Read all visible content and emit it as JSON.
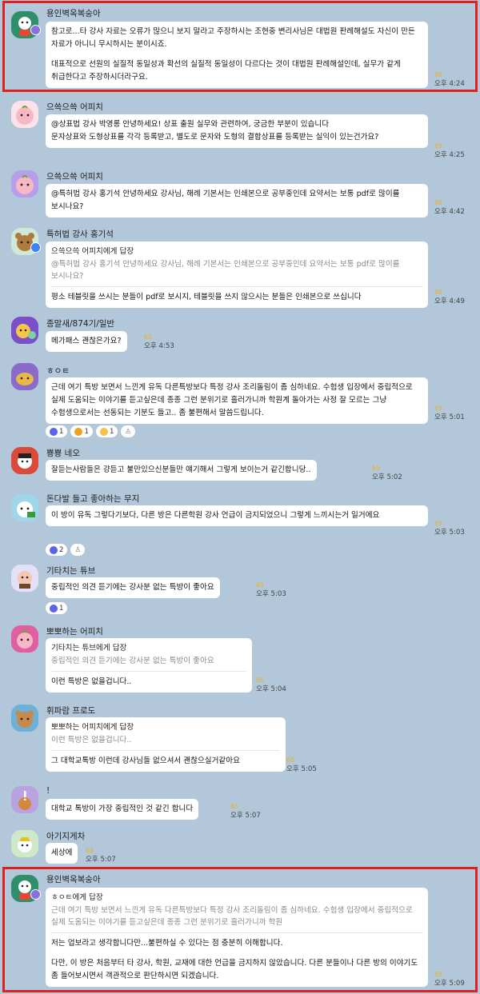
{
  "messages": [
    {
      "name": "용인벽옥복숭아",
      "lines": [
        "참고로...타 강사 자료는 오류가 많으니 보지 말라고 주장하시는 조현중 변리사님은 대법원 판례해설도 자신이 만든 자료가 아니니 무시하시는 분이시죠.",
        "",
        "대표적으로 선원의 실질적 동일성과 확선의 실질적 동일성이 다르다는 것이 대법원 판례해설인데, 실무가 같게 취급한다고 주장하시더라구요."
      ],
      "unread": "65",
      "time": "오후 4:24"
    },
    {
      "name": "으쓱으쓱 어피치",
      "lines": [
        "@상표법 강사 박영롱 안녕하세요! 상표 출원 실무와 관련하여, 궁금한 부분이 있습니다",
        "문자상표와 도형상표를 각각 등록받고, 별도로 문자와 도형의 결합상표를 등록받는 실익이 있는건가요?"
      ],
      "unread": "65",
      "time": "오후 4:25"
    },
    {
      "name": "으쓱으쓱 어피치",
      "lines": [
        "@특허법 강사 홍기석 안녕하세요 강사님, 해례 기본서는 인쇄본으로 공부중인데 요약서는 보통 pdf로 많이를 보시나요?"
      ],
      "unread": "65",
      "time": "오후 4:42"
    },
    {
      "name": "특허법 강사 홍기석",
      "quote_to": "으쓱으쓱 어피치에게 답장",
      "quote": "@특허법 강사 홍기석 안녕하세요 강사님, 해례 기본서는 인쇄본으로 공부중인데 요약서는 보통 pdf로 많이를 보시나요?",
      "lines": [
        "평소 테블릿을 쓰시는 분들이 pdf로 보시지, 테블릿을 쓰지 않으시는 분들은 인쇄본으로 쓰십니다"
      ],
      "unread": "65",
      "time": "오후 4:49"
    },
    {
      "name": "종말새/874기/일반",
      "lines": [
        "메가패스 괜찮은가요?"
      ],
      "unread": "65",
      "time": "오후 4:53"
    },
    {
      "name": "ㅎㅇㅌ",
      "lines": [
        "근데 여기 특방 보면서 느낀게 유독 다른특방보다 특정 강사 조리돌림이 좀 심하네요. 수험생 입장에서 중립적으로 실제 도움되는 이야기를 듣고싶은데 종종 그런 분위기로 흘러가니까 학원계 돌아가는 사정 잘 모르는 그냥 수험생으로서는 선동되는 기분도 들고.. 좀 불편해서 말씀드립니다."
      ],
      "unread": "65",
      "time": "오후 5:01",
      "reactions": [
        "1",
        "1",
        "1"
      ]
    },
    {
      "name": "뿅뿅 네오",
      "lines": [
        "잘듣는사람들은 걍듣고 불만있으신분들만 얘기해서 그렇게 보이는거 같긴합니당.."
      ],
      "unread": "65",
      "time": "오후 5:02"
    },
    {
      "name": "돈다발 들고 좋아하는 무지",
      "lines": [
        "이 방이 유독 그렇다기보다, 다른 방은 다른학원 강사 언급이 금지되었으니 그렇게 느끼시는거 일거에요"
      ],
      "unread": "65",
      "time": "오후 5:03",
      "reactions": [
        "2"
      ]
    },
    {
      "name": "기타치는 튜브",
      "lines": [
        "중립적인 의견 듣기에는 강사분 없는 특방이 좋아요"
      ],
      "unread": "65",
      "time": "오후 5:03",
      "reactions": [
        "1"
      ]
    },
    {
      "name": "뽀뽀하는 어피치",
      "quote_to": "기타치는 튜브에게 답장",
      "quote": "중립적인 의견 듣기에는 강사분 없는 특방이 좋아요",
      "lines": [
        "이런 특방은 없을겁니다.."
      ],
      "unread": "65",
      "time": "오후 5:04"
    },
    {
      "name": "휘파람 프로도",
      "quote_to": "뽀뽀하는 어피치에게 답장",
      "quote": "이런 특방은 없을겁니다..",
      "lines": [
        "그 대학교톡방 이런데 강사님들 없으셔서 괜찮으실거같아요"
      ],
      "unread": "65",
      "time": "오후 5:05"
    },
    {
      "name": "!",
      "lines": [
        "대학교 톡방이 가장 중립적인 것 같긴 합니다"
      ],
      "unread": "65",
      "time": "오후 5:07"
    },
    {
      "name": "아기지게차",
      "lines": [
        "세상에"
      ],
      "unread": "65",
      "time": "오후 5:07"
    },
    {
      "name": "용인벽옥복숭아",
      "quote_to": "ㅎㅇㅌ에게 답장",
      "quote": "근데 여기 특방 보면서 느낀게 유독 다른특방보다 특정 강사 조리돌림이 좀 심하네요. 수험생 입장에서 중립적으로 실제 도움되는 이야기를 듣고싶은데 종종 그런 분위기로 흘러가니까 학원",
      "lines": [
        "저는 업보라고 생각합니다만...불편하실 수 있다는 점 충분히 이해합니다.",
        "",
        "다만, 이 방은 처음부터 타 강사, 학원, 교재에 대한 언급을 금지하지 않았습니다. 다른 분들이나 다른 방의 이야기도 좀 들어보시면서 객관적으로 판단하시면 되겠습니다."
      ],
      "unread": "65",
      "time": "오후 5:09"
    }
  ],
  "colors": {
    "background": "#b2c7da",
    "highlight": "#e02020",
    "unread": "#e8b317"
  }
}
